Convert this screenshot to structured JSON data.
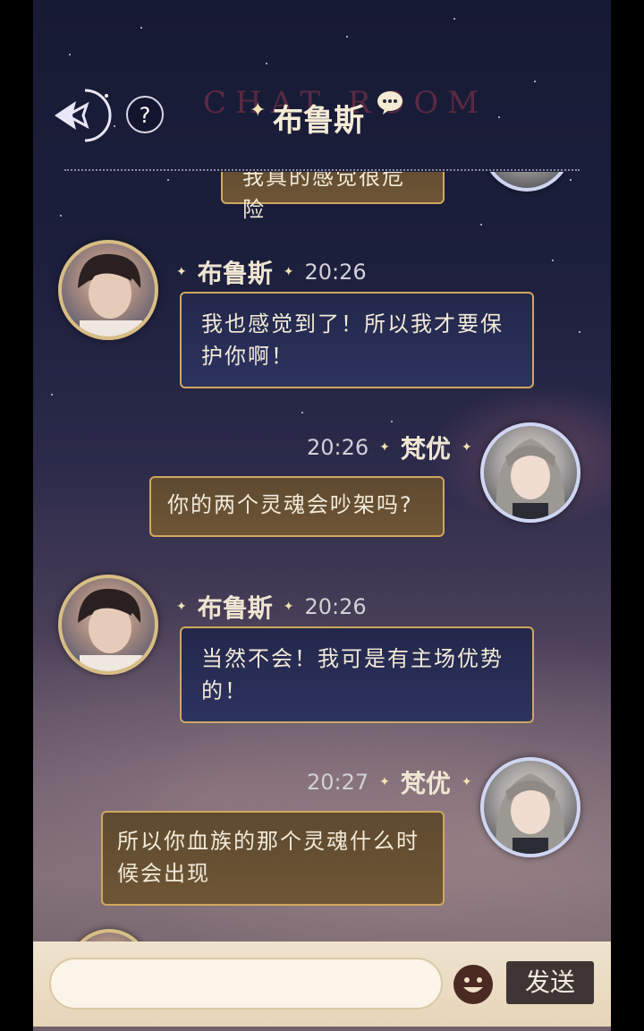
{
  "header": {
    "title": "布鲁斯",
    "bg_text": "CHAT ROOM",
    "help_label": "?"
  },
  "messages": [
    {
      "sender": "布鲁斯",
      "time": "20:26",
      "text": "我也感觉到了！所以我才要保护你啊！"
    },
    {
      "sender": "梵优",
      "time": "20:26",
      "text": "你的两个灵魂会吵架吗?"
    },
    {
      "sender": "布鲁斯",
      "time": "20:26",
      "text": "当然不会！我可是有主场优势的！"
    },
    {
      "sender": "梵优",
      "time": "20:27",
      "text": "所以你血族的那个灵魂什么时候会出现"
    }
  ],
  "partial_top_message": "我真的感觉很危险",
  "input": {
    "value": "",
    "placeholder": ""
  },
  "send_label": "发送",
  "colors": {
    "bubble_border": "#cfa75e",
    "blue_bubble": "#2d3360",
    "gold_bubble": "#6e5535",
    "input_bar": "#efe3ce",
    "send_button": "#3e3634"
  }
}
